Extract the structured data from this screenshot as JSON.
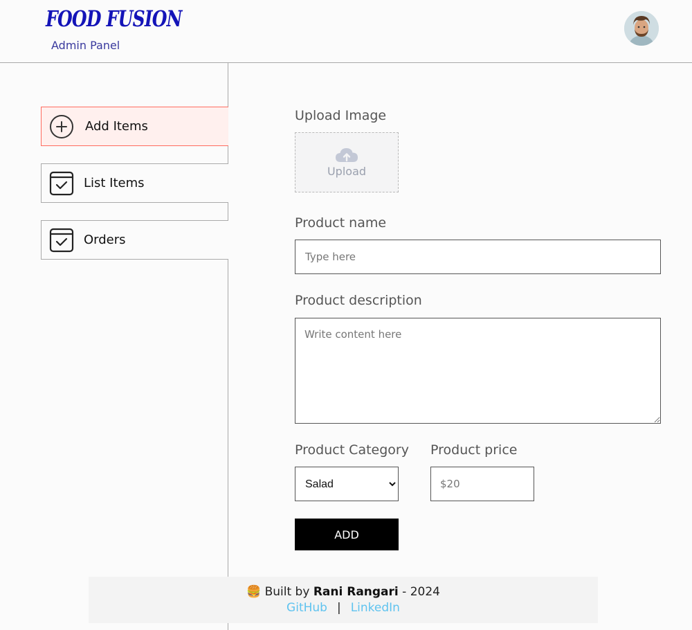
{
  "header": {
    "logo": "FOOD FUSION",
    "subtitle": "Admin Panel",
    "avatar_icon": "user-avatar"
  },
  "sidebar": {
    "items": [
      {
        "label": "Add Items",
        "icon": "plus-circle-icon",
        "active": true
      },
      {
        "label": "List Items",
        "icon": "checkbox-list-icon",
        "active": false
      },
      {
        "label": "Orders",
        "icon": "checkbox-order-icon",
        "active": false
      }
    ]
  },
  "form": {
    "upload_label": "Upload Image",
    "upload_text": "Upload",
    "name_label": "Product name",
    "name_placeholder": "Type here",
    "description_label": "Product description",
    "description_placeholder": "Write content here",
    "category_label": "Product Category",
    "category_selected": "Salad",
    "price_label": "Product price",
    "price_placeholder": "$20",
    "add_button": "ADD"
  },
  "footer": {
    "emoji": "🍔",
    "built_by": "Built by",
    "author": "Rani Rangari",
    "year_text": "- 2024",
    "github": "GitHub",
    "separator": "|",
    "linkedin": "LinkedIn"
  },
  "colors": {
    "logo": "#1414b8",
    "active_bg": "#fff0ee",
    "active_border": "#ff6b5e",
    "link": "#5fc3ef",
    "button": "#000000"
  }
}
